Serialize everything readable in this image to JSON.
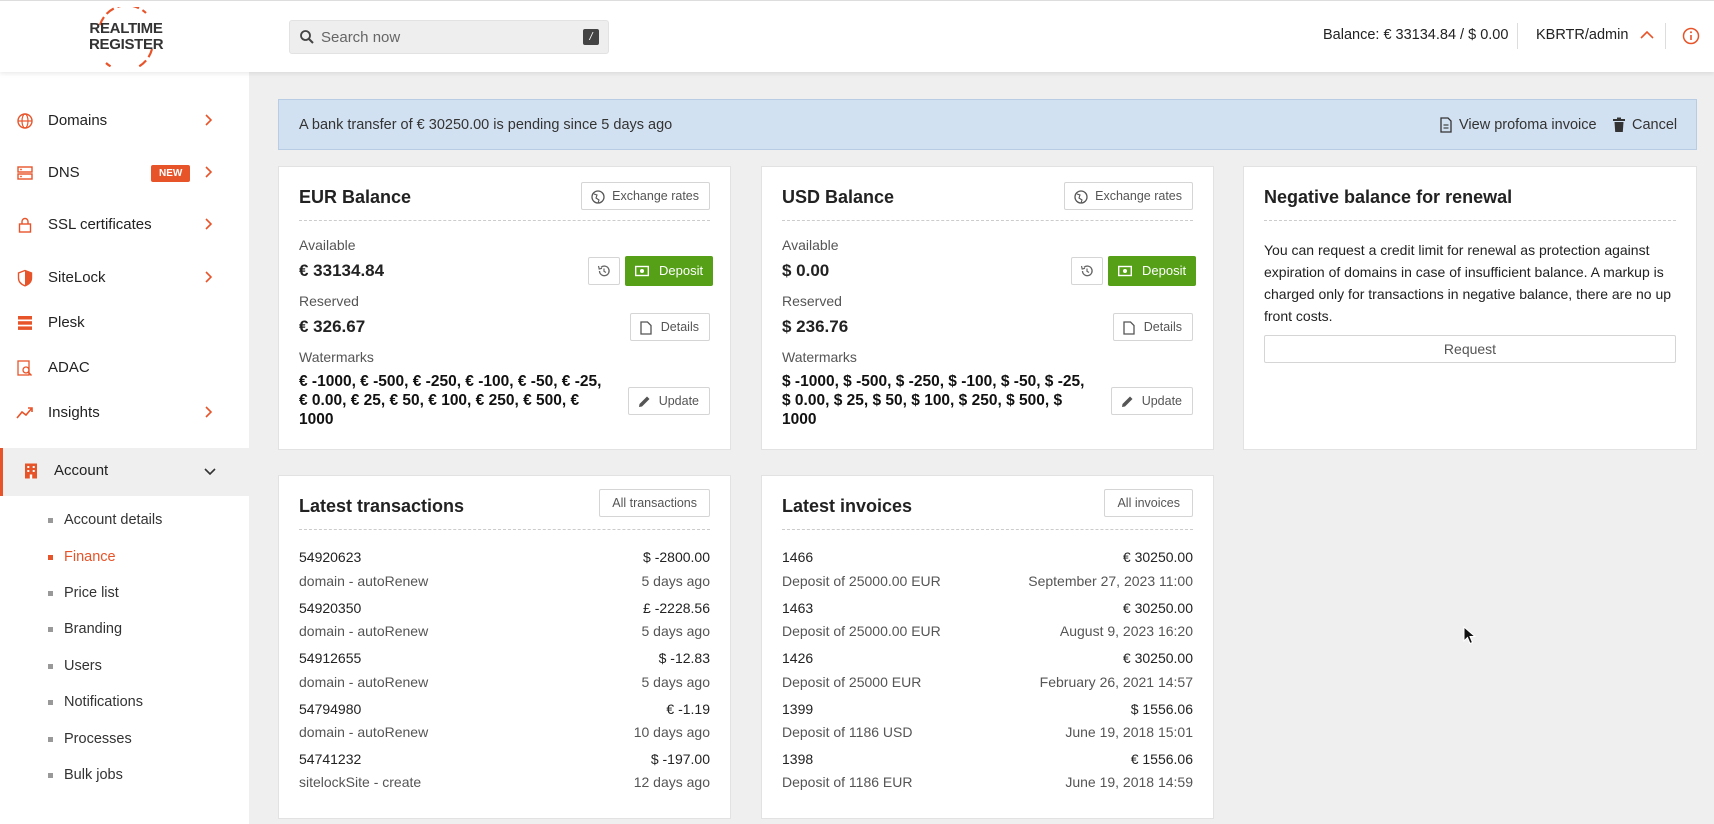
{
  "header": {
    "logo_line1": "REALTIME",
    "logo_line2": "REGISTER",
    "search_placeholder": "Search now",
    "search_shortcut": "/",
    "balance": "Balance: € 33134.84 / $ 0.00",
    "user": "KBRTR/admin",
    "icons": {
      "search": "search-icon",
      "user_toggle": "chevron-up-icon",
      "info": "info-icon"
    }
  },
  "sidebar": {
    "items": [
      {
        "label": "Domains",
        "icon": "globe-icon",
        "has_arrow": true
      },
      {
        "label": "DNS",
        "icon": "server-icon",
        "badge": "NEW",
        "has_arrow": true
      },
      {
        "label": "SSL certificates",
        "icon": "lock-icon",
        "has_arrow": true
      },
      {
        "label": "SiteLock",
        "icon": "shield-icon",
        "has_arrow": true
      },
      {
        "label": "Plesk",
        "icon": "stack-icon",
        "has_arrow": false
      },
      {
        "label": "ADAC",
        "icon": "search-doc-icon",
        "has_arrow": false
      },
      {
        "label": "Insights",
        "icon": "trend-icon",
        "has_arrow": true
      },
      {
        "label": "Account",
        "icon": "building-icon",
        "expanded": true
      }
    ],
    "account_sub": [
      {
        "label": "Account details"
      },
      {
        "label": "Finance",
        "active": true
      },
      {
        "label": "Price list"
      },
      {
        "label": "Branding"
      },
      {
        "label": "Users"
      },
      {
        "label": "Notifications"
      },
      {
        "label": "Processes"
      },
      {
        "label": "Bulk jobs"
      }
    ]
  },
  "alert": {
    "message": "A bank transfer of € 30250.00 is pending since 5 days ago",
    "view_label": "View profoma invoice",
    "cancel_label": "Cancel"
  },
  "eur": {
    "title": "EUR Balance",
    "exchange_label": "Exchange rates",
    "available_label": "Available",
    "available": "€ 33134.84",
    "deposit_label": "Deposit",
    "reserved_label": "Reserved",
    "reserved": "€ 326.67",
    "details_label": "Details",
    "watermarks_label": "Watermarks",
    "watermarks": "€ -1000, € -500, € -250, € -100, € -50, € -25, € 0.00, € 25, € 50, € 100, € 250, € 500, € 1000",
    "update_label": "Update"
  },
  "usd": {
    "title": "USD Balance",
    "exchange_label": "Exchange rates",
    "available_label": "Available",
    "available": "$ 0.00",
    "deposit_label": "Deposit",
    "reserved_label": "Reserved",
    "reserved": "$ 236.76",
    "details_label": "Details",
    "watermarks_label": "Watermarks",
    "watermarks": "$ -1000, $ -500, $ -250, $ -100, $ -50, $ -25, $ 0.00, $ 25, $ 50, $ 100, $ 250, $ 500, $ 1000",
    "update_label": "Update"
  },
  "negative": {
    "title": "Negative balance for renewal",
    "description": "You can request a credit limit for renewal as protection against expiration of domains in case of insufficient balance. A markup is charged only for transactions in negative balance, there are no up front costs.",
    "request_label": "Request"
  },
  "transactions": {
    "title": "Latest transactions",
    "all_label": "All transactions",
    "rows": [
      {
        "id": "54920623",
        "amount": "$ -2800.00",
        "desc": "domain - autoRenew",
        "when": "5 days ago"
      },
      {
        "id": "54920350",
        "amount": "£ -2228.56",
        "desc": "domain - autoRenew",
        "when": "5 days ago"
      },
      {
        "id": "54912655",
        "amount": "$ -12.83",
        "desc": "domain - autoRenew",
        "when": "5 days ago"
      },
      {
        "id": "54794980",
        "amount": "€ -1.19",
        "desc": "domain - autoRenew",
        "when": "10 days ago"
      },
      {
        "id": "54741232",
        "amount": "$ -197.00",
        "desc": "sitelockSite - create",
        "when": "12 days ago"
      }
    ]
  },
  "invoices": {
    "title": "Latest invoices",
    "all_label": "All invoices",
    "rows": [
      {
        "id": "1466",
        "amount": "€ 30250.00",
        "desc": "Deposit of 25000.00 EUR",
        "when": "September 27, 2023 11:00"
      },
      {
        "id": "1463",
        "amount": "€ 30250.00",
        "desc": "Deposit of 25000.00 EUR",
        "when": "August 9, 2023 16:20"
      },
      {
        "id": "1426",
        "amount": "€ 30250.00",
        "desc": "Deposit of 25000 EUR",
        "when": "February 26, 2021 14:57"
      },
      {
        "id": "1399",
        "amount": "$ 1556.06",
        "desc": "Deposit of 1186 USD",
        "when": "June 19, 2018 15:01"
      },
      {
        "id": "1398",
        "amount": "€ 1556.06",
        "desc": "Deposit of 1186 EUR",
        "when": "June 19, 2018 14:59"
      }
    ]
  },
  "colors": {
    "accent": "#e8542a",
    "deposit": "#55a017",
    "alert_bg": "#d2e1f1"
  }
}
